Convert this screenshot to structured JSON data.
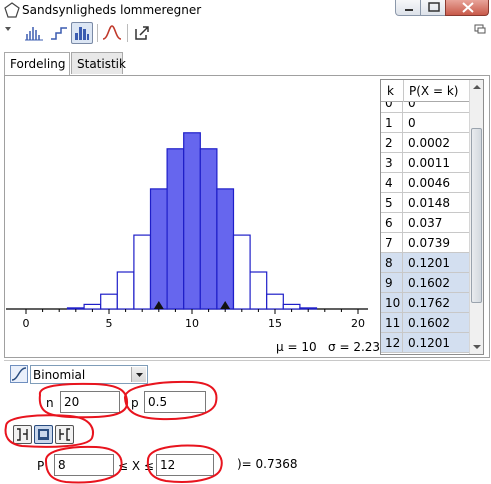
{
  "window": {
    "title": "Sandsynligheds lommeregner"
  },
  "tabs": [
    {
      "label": "Fordeling",
      "active": true
    },
    {
      "label": "Statistik",
      "active": false
    }
  ],
  "table": {
    "headers": [
      "k",
      "P(X = k)"
    ],
    "rows": [
      {
        "k": "0",
        "p": "0",
        "highlight": false
      },
      {
        "k": "1",
        "p": "0",
        "highlight": false
      },
      {
        "k": "2",
        "p": "0.0002",
        "highlight": false
      },
      {
        "k": "3",
        "p": "0.0011",
        "highlight": false
      },
      {
        "k": "4",
        "p": "0.0046",
        "highlight": false
      },
      {
        "k": "5",
        "p": "0.0148",
        "highlight": false
      },
      {
        "k": "6",
        "p": "0.037",
        "highlight": false
      },
      {
        "k": "7",
        "p": "0.0739",
        "highlight": false
      },
      {
        "k": "8",
        "p": "0.1201",
        "highlight": true
      },
      {
        "k": "9",
        "p": "0.1602",
        "highlight": true
      },
      {
        "k": "10",
        "p": "0.1762",
        "highlight": true
      },
      {
        "k": "11",
        "p": "0.1602",
        "highlight": true
      },
      {
        "k": "12",
        "p": "0.1201",
        "highlight": true
      }
    ]
  },
  "stats": {
    "mu": "μ = 10",
    "sigma": "σ = 2.2361"
  },
  "controls": {
    "distribution": "Binomial",
    "n_label": "n",
    "n_value": "20",
    "p_label": "p",
    "p_value": "0.5",
    "prob_label": "P",
    "lower_value": "8",
    "between": "≤ X ≤",
    "upper_value": "12",
    "result": ")=  0.7368"
  },
  "colors": {
    "highlight_fill": "#6666ee",
    "highlight_stroke": "#1e1ec8",
    "outline": "#1e1ec8",
    "annotation": "#e8141e"
  },
  "chart_data": {
    "type": "bar",
    "distribution": "Binomial n=20 p=0.5",
    "x": [
      0,
      1,
      2,
      3,
      4,
      5,
      6,
      7,
      8,
      9,
      10,
      11,
      12,
      13,
      14,
      15,
      16,
      17,
      18,
      19,
      20
    ],
    "values": [
      0,
      0,
      0.0002,
      0.0011,
      0.0046,
      0.0148,
      0.037,
      0.0739,
      0.1201,
      0.1602,
      0.1762,
      0.1602,
      0.1201,
      0.0739,
      0.037,
      0.0148,
      0.0046,
      0.0011,
      0.0002,
      0,
      0
    ],
    "highlight_range": [
      8,
      12
    ],
    "xticks": [
      "0",
      "5",
      "10",
      "15",
      "20"
    ],
    "xlim": [
      -1,
      21
    ],
    "ylim": [
      0,
      0.2
    ]
  }
}
